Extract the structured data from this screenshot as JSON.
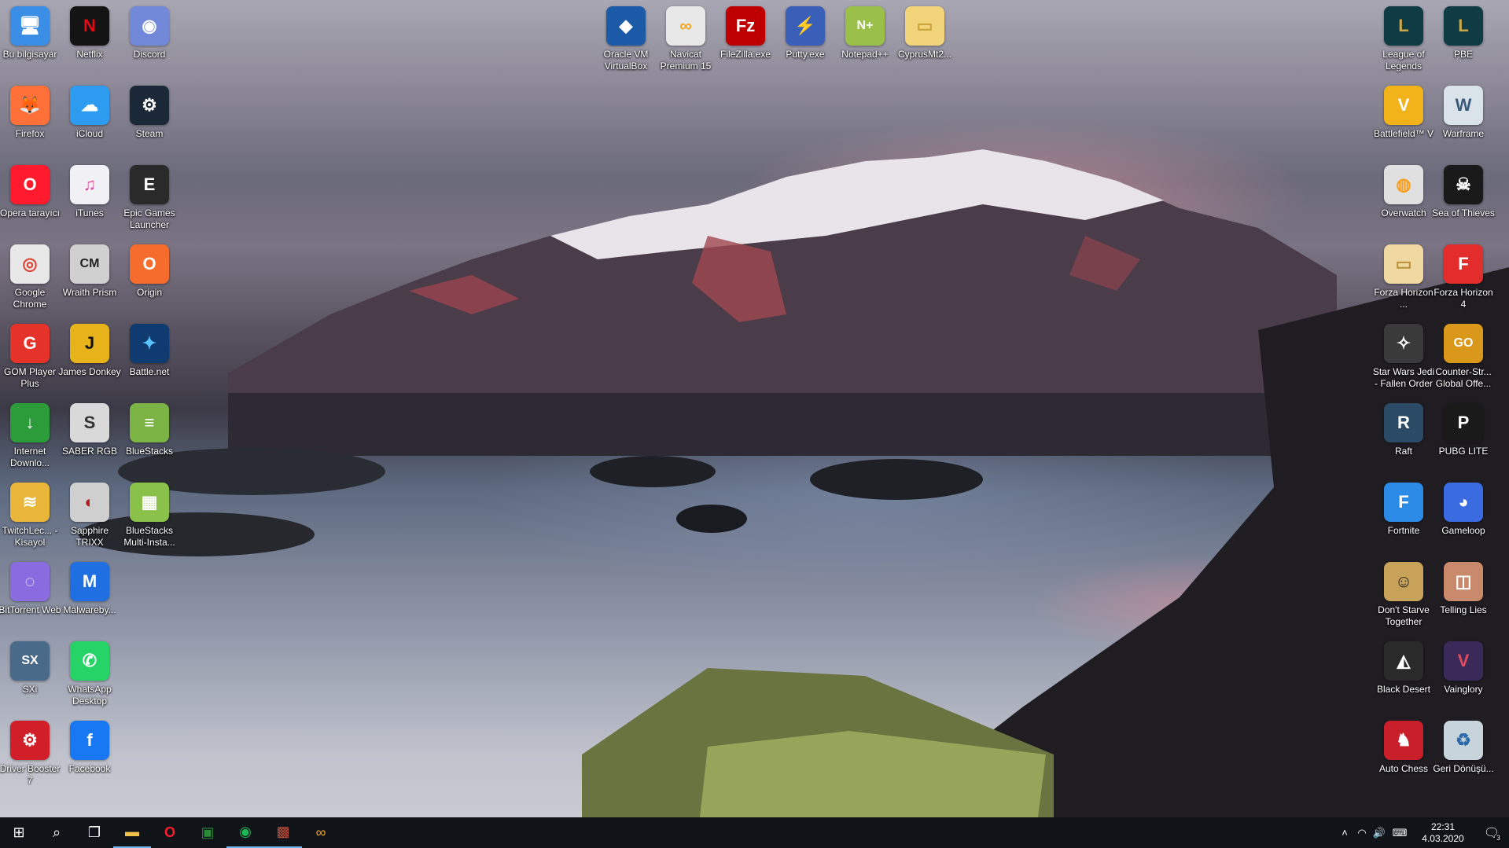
{
  "desktop_icons": {
    "left": [
      {
        "label": "Bu bilgisayar",
        "icon": "computer-icon",
        "color": "#3a8ee6",
        "glyph": "🖥"
      },
      {
        "label": "Netflix",
        "icon": "netflix-icon",
        "color": "#141414",
        "glyph": "N"
      },
      {
        "label": "Discord",
        "icon": "discord-icon",
        "color": "#7289da",
        "glyph": "◉"
      },
      {
        "label": "Firefox",
        "icon": "firefox-icon",
        "color": "#ff7139",
        "glyph": "🦊"
      },
      {
        "label": "iCloud",
        "icon": "icloud-icon",
        "color": "#2d9cf0",
        "glyph": "☁"
      },
      {
        "label": "Steam",
        "icon": "steam-icon",
        "color": "#1b2838",
        "glyph": "⚙"
      },
      {
        "label": "Opera tarayıcı",
        "icon": "opera-icon",
        "color": "#ff1b2d",
        "glyph": "O"
      },
      {
        "label": "iTunes",
        "icon": "itunes-icon",
        "color": "#f0f0f5",
        "glyph": "♫"
      },
      {
        "label": "Epic Games Launcher",
        "icon": "epic-games-icon",
        "color": "#2a2a2a",
        "glyph": "E"
      },
      {
        "label": "Google Chrome",
        "icon": "chrome-icon",
        "color": "#e8e8e8",
        "glyph": "◎"
      },
      {
        "label": "Wraith Prism",
        "icon": "wraith-prism-icon",
        "color": "#d0d0d0",
        "glyph": "CM"
      },
      {
        "label": "Origin",
        "icon": "origin-icon",
        "color": "#f56c2d",
        "glyph": "O"
      },
      {
        "label": "GOM Player Plus",
        "icon": "gom-player-icon",
        "color": "#e6332a",
        "glyph": "G"
      },
      {
        "label": "James Donkey",
        "icon": "james-donkey-icon",
        "color": "#e7b21a",
        "glyph": "J"
      },
      {
        "label": "Battle.net",
        "icon": "battlenet-icon",
        "color": "#0f3b70",
        "glyph": "✦"
      },
      {
        "label": "Internet Downlo...",
        "icon": "idm-icon",
        "color": "#2c9b3a",
        "glyph": "↓"
      },
      {
        "label": "SABER RGB",
        "icon": "saber-rgb-icon",
        "color": "#d9d9d9",
        "glyph": "S"
      },
      {
        "label": "BlueStacks",
        "icon": "bluestacks-icon",
        "color": "#7bb344",
        "glyph": "≡"
      },
      {
        "label": "TwitchLec... - Kisayol",
        "icon": "twitch-icon",
        "color": "#e9b63a",
        "glyph": "≋"
      },
      {
        "label": "Sapphire TRIXX",
        "icon": "sapphire-trixx-icon",
        "color": "#cfcfcf",
        "glyph": "◐"
      },
      {
        "label": "BlueStacks Multi-Insta...",
        "icon": "bluestacks-multi-icon",
        "color": "#8ac14a",
        "glyph": "▦"
      },
      {
        "label": "BitTorrent Web",
        "icon": "bittorrent-icon",
        "color": "#8a6ce0",
        "glyph": "◌"
      },
      {
        "label": "Malwareby...",
        "icon": "malwarebytes-icon",
        "color": "#1f6fe0",
        "glyph": "M"
      },
      {
        "label": "SXi",
        "icon": "sxi-icon",
        "color": "#4a6a8a",
        "glyph": "SX"
      },
      {
        "label": "WhatsApp Desktop",
        "icon": "whatsapp-icon",
        "color": "#25d366",
        "glyph": "✆"
      },
      {
        "label": "Driver Booster 7",
        "icon": "driver-booster-icon",
        "color": "#d11f2a",
        "glyph": "⚙"
      },
      {
        "label": "Facebook",
        "icon": "facebook-icon",
        "color": "#1877f2",
        "glyph": "f"
      }
    ],
    "top": [
      {
        "label": "Oracle VM VirtualBox",
        "icon": "virtualbox-icon",
        "color": "#1b5aa6",
        "glyph": "◆"
      },
      {
        "label": "Navicat Premium 15",
        "icon": "navicat-icon",
        "color": "#e8e8e8",
        "glyph": "∞"
      },
      {
        "label": "FileZilla.exe",
        "icon": "filezilla-icon",
        "color": "#bf0000",
        "glyph": "Fz"
      },
      {
        "label": "Putty.exe",
        "icon": "putty-icon",
        "color": "#3a5fb8",
        "glyph": "⚡"
      },
      {
        "label": "Notepad++",
        "icon": "notepadpp-icon",
        "color": "#9ac04a",
        "glyph": "N+"
      },
      {
        "label": "CyprusMt2...",
        "icon": "folder-icon",
        "color": "#f2d57a",
        "glyph": "▭"
      }
    ],
    "right": [
      {
        "label": "League of Legends",
        "icon": "league-of-legends-icon",
        "color": "#0e3b44",
        "glyph": "L"
      },
      {
        "label": "PBE",
        "icon": "pbe-icon",
        "color": "#0e3b44",
        "glyph": "L"
      },
      {
        "label": "Battlefield™ V",
        "icon": "battlefield-icon",
        "color": "#f2b21a",
        "glyph": "V"
      },
      {
        "label": "Warframe",
        "icon": "warframe-icon",
        "color": "#d9e3e9",
        "glyph": "W"
      },
      {
        "label": "Overwatch",
        "icon": "overwatch-icon",
        "color": "#e0e0e0",
        "glyph": "◍"
      },
      {
        "label": "Sea of Thieves",
        "icon": "sea-of-thieves-icon",
        "color": "#1a1a1a",
        "glyph": "☠"
      },
      {
        "label": "Forza Horizon ...",
        "icon": "forza-folder-icon",
        "color": "#f0d9a0",
        "glyph": "▭"
      },
      {
        "label": "Forza Horizon 4",
        "icon": "forza-horizon-4-icon",
        "color": "#e32d2d",
        "glyph": "F"
      },
      {
        "label": "Star Wars Jedi - Fallen Order",
        "icon": "star-wars-jedi-icon",
        "color": "#3a3a3a",
        "glyph": "✧"
      },
      {
        "label": "Counter-Str... Global Offe...",
        "icon": "csgo-icon",
        "color": "#d9981a",
        "glyph": "GO"
      },
      {
        "label": "Raft",
        "icon": "raft-icon",
        "color": "#2a4a66",
        "glyph": "R"
      },
      {
        "label": "PUBG LITE",
        "icon": "pubg-lite-icon",
        "color": "#1a1a1a",
        "glyph": "P"
      },
      {
        "label": "Fortnite",
        "icon": "fortnite-icon",
        "color": "#2b8be6",
        "glyph": "F"
      },
      {
        "label": "Gameloop",
        "icon": "gameloop-icon",
        "color": "#3b6be0",
        "glyph": "◕"
      },
      {
        "label": "Don't Starve Together",
        "icon": "dont-starve-icon",
        "color": "#c9a25a",
        "glyph": "☺"
      },
      {
        "label": "Telling Lies",
        "icon": "telling-lies-icon",
        "color": "#c88a6a",
        "glyph": "◫"
      },
      {
        "label": "Black Desert",
        "icon": "black-desert-icon",
        "color": "#2a2a2a",
        "glyph": "◭"
      },
      {
        "label": "Vainglory",
        "icon": "vainglory-icon",
        "color": "#3a2a5a",
        "glyph": "V"
      },
      {
        "label": "Auto Chess",
        "icon": "auto-chess-icon",
        "color": "#c81f2a",
        "glyph": "♞"
      },
      {
        "label": "Geri Dönüşü...",
        "icon": "recycle-bin-icon",
        "color": "#c8d4dc",
        "glyph": "♻"
      }
    ]
  },
  "taskbar": {
    "start": "⊞",
    "search": "⌕",
    "task_view": "❐",
    "apps": [
      {
        "name": "file-explorer-icon",
        "glyph": "▬",
        "color": "#f2c14a",
        "active": true
      },
      {
        "name": "opera-icon",
        "glyph": "O",
        "color": "#ff1b2d",
        "active": false
      },
      {
        "name": "terminal-icon",
        "glyph": "▣",
        "color": "#2a8a3a",
        "active": false
      },
      {
        "name": "spotify-icon",
        "glyph": "◉",
        "color": "#1db954",
        "active": true
      },
      {
        "name": "game-icon",
        "glyph": "▩",
        "color": "#9a3a2a",
        "active": true
      },
      {
        "name": "navicat-icon",
        "glyph": "∞",
        "color": "#f5a623",
        "active": false
      }
    ],
    "tray": {
      "chevron": "˄",
      "network": "◠",
      "volume": "🔊",
      "keyboard": "⌨",
      "time": "22:31",
      "date": "4.03.2020",
      "notifications": "3"
    }
  }
}
